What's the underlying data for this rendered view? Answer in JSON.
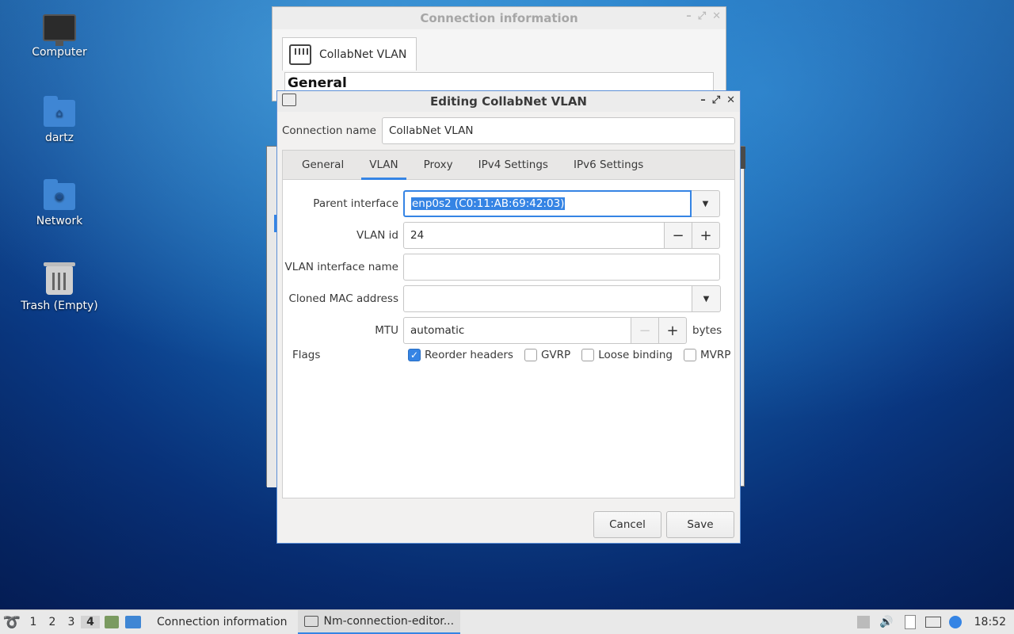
{
  "desktop": {
    "icons": [
      {
        "label": "Computer"
      },
      {
        "label": "dartz"
      },
      {
        "label": "Network"
      },
      {
        "label": "Trash (Empty)"
      }
    ]
  },
  "conninfo_window": {
    "title": "Connection information",
    "tab_label": "CollabNet VLAN",
    "section_title": "General"
  },
  "editor": {
    "title": "Editing CollabNet VLAN",
    "connection_name_label": "Connection name",
    "connection_name_value": "CollabNet VLAN",
    "tabs": [
      "General",
      "VLAN",
      "Proxy",
      "IPv4 Settings",
      "IPv6 Settings"
    ],
    "active_tab": "VLAN",
    "fields": {
      "parent_interface_label": "Parent interface",
      "parent_interface_value": "enp0s2 (C0:11:AB:69:42:03)",
      "vlan_id_label": "VLAN id",
      "vlan_id_value": "24",
      "vlan_iface_name_label": "VLAN interface name",
      "vlan_iface_name_value": "",
      "cloned_mac_label": "Cloned MAC address",
      "cloned_mac_value": "",
      "mtu_label": "MTU",
      "mtu_value": "automatic",
      "mtu_unit": "bytes",
      "flags_label": "Flags"
    },
    "flags": [
      {
        "label": "Reorder headers",
        "checked": true
      },
      {
        "label": "GVRP",
        "checked": false
      },
      {
        "label": "Loose binding",
        "checked": false
      },
      {
        "label": "MVRP",
        "checked": false
      }
    ],
    "buttons": {
      "cancel": "Cancel",
      "save": "Save"
    }
  },
  "taskbar": {
    "workspaces": [
      "1",
      "2",
      "3",
      "4"
    ],
    "active_workspace": "4",
    "tasks": [
      {
        "label": "Connection information",
        "active": false
      },
      {
        "label": "Nm-connection-editor...",
        "active": true
      }
    ],
    "clock": "18:52"
  },
  "colors": {
    "accent": "#3584e4",
    "window_bg": "#f2f1f0",
    "taskbar_bg": "#e9e9e9"
  }
}
